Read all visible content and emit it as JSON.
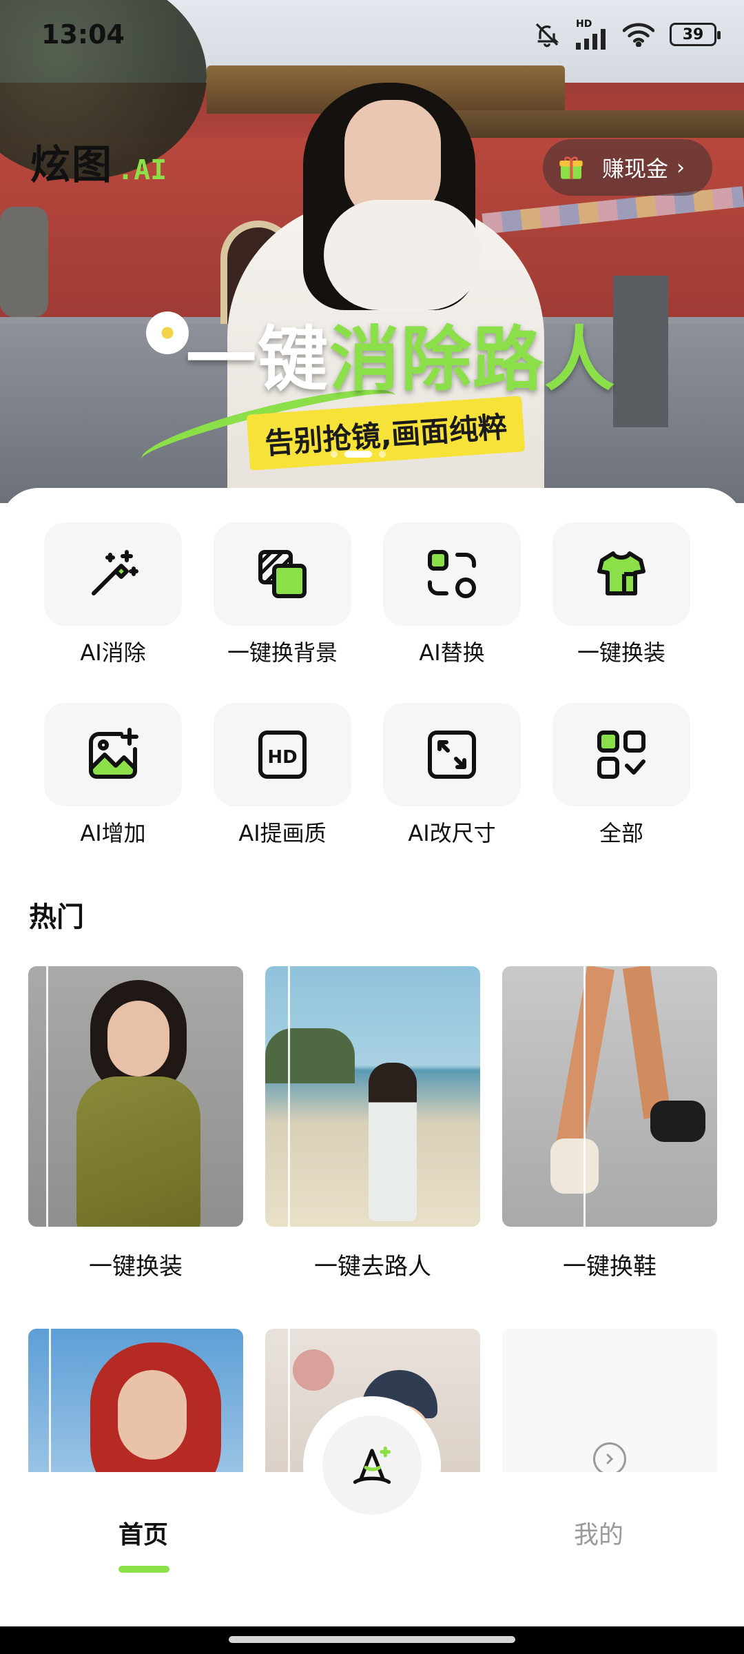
{
  "status_bar": {
    "time": "13:04",
    "battery": "39",
    "network": "HD"
  },
  "header": {
    "logo_main": "炫图",
    "logo_suffix": ".AI",
    "cash_button": "赚现金"
  },
  "banner": {
    "title_part1": "一键",
    "title_highlight": "消除路人",
    "subtitle": "告别抢镜,画面纯粹",
    "page_count": 3,
    "active_page": 2
  },
  "tools": [
    {
      "label": "AI消除",
      "icon": "magic-wand-icon"
    },
    {
      "label": "一键换背景",
      "icon": "layers-icon"
    },
    {
      "label": "AI替换",
      "icon": "swap-icon"
    },
    {
      "label": "一键换装",
      "icon": "tshirt-icon"
    },
    {
      "label": "AI增加",
      "icon": "image-add-icon"
    },
    {
      "label": "AI提画质",
      "icon": "hd-icon"
    },
    {
      "label": "AI改尺寸",
      "icon": "resize-icon"
    },
    {
      "label": "全部",
      "icon": "grid-check-icon"
    }
  ],
  "hot": {
    "title": "热门",
    "items": [
      {
        "label": "一键换装"
      },
      {
        "label": "一键去路人"
      },
      {
        "label": "一键换鞋"
      }
    ]
  },
  "nav": {
    "home": "首页",
    "mine": "我的",
    "center_icon": "wizard-hat-icon"
  },
  "colors": {
    "accent": "#8be04a",
    "banner_yellow": "#f7e23a"
  }
}
